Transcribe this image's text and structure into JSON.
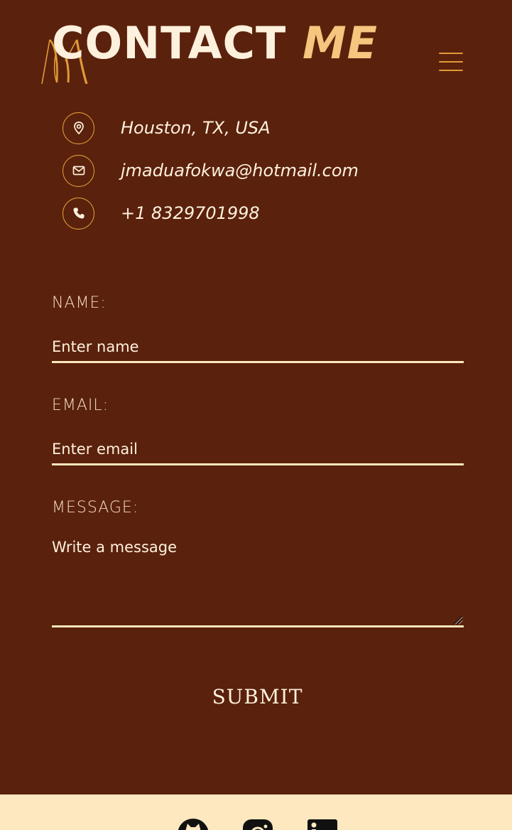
{
  "header": {
    "title_main": "CONTACT ",
    "title_accent": "ME",
    "logo_text": "JM",
    "menu_icon": "hamburger-menu-icon"
  },
  "contact": {
    "items": [
      {
        "icon": "location-pin-icon",
        "text": "Houston, TX, USA"
      },
      {
        "icon": "mail-icon",
        "text": "jmaduafokwa@hotmail.com"
      },
      {
        "icon": "phone-icon",
        "text": "+1 8329701998"
      }
    ]
  },
  "form": {
    "name_label": "NAME:",
    "name_placeholder": "Enter name",
    "email_label": "EMAIL:",
    "email_placeholder": "Enter email",
    "message_label": "MESSAGE:",
    "message_placeholder": "Write a message",
    "submit_label": "SUBMIT"
  },
  "footer": {
    "social": [
      {
        "icon": "github-icon"
      },
      {
        "icon": "instagram-icon"
      },
      {
        "icon": "linkedin-icon"
      }
    ]
  },
  "colors": {
    "background": "#5a210c",
    "accent": "#e09a37",
    "accent_light": "#f6c57e",
    "text": "#fdf1dd",
    "footer_bg": "#fde8bf"
  }
}
